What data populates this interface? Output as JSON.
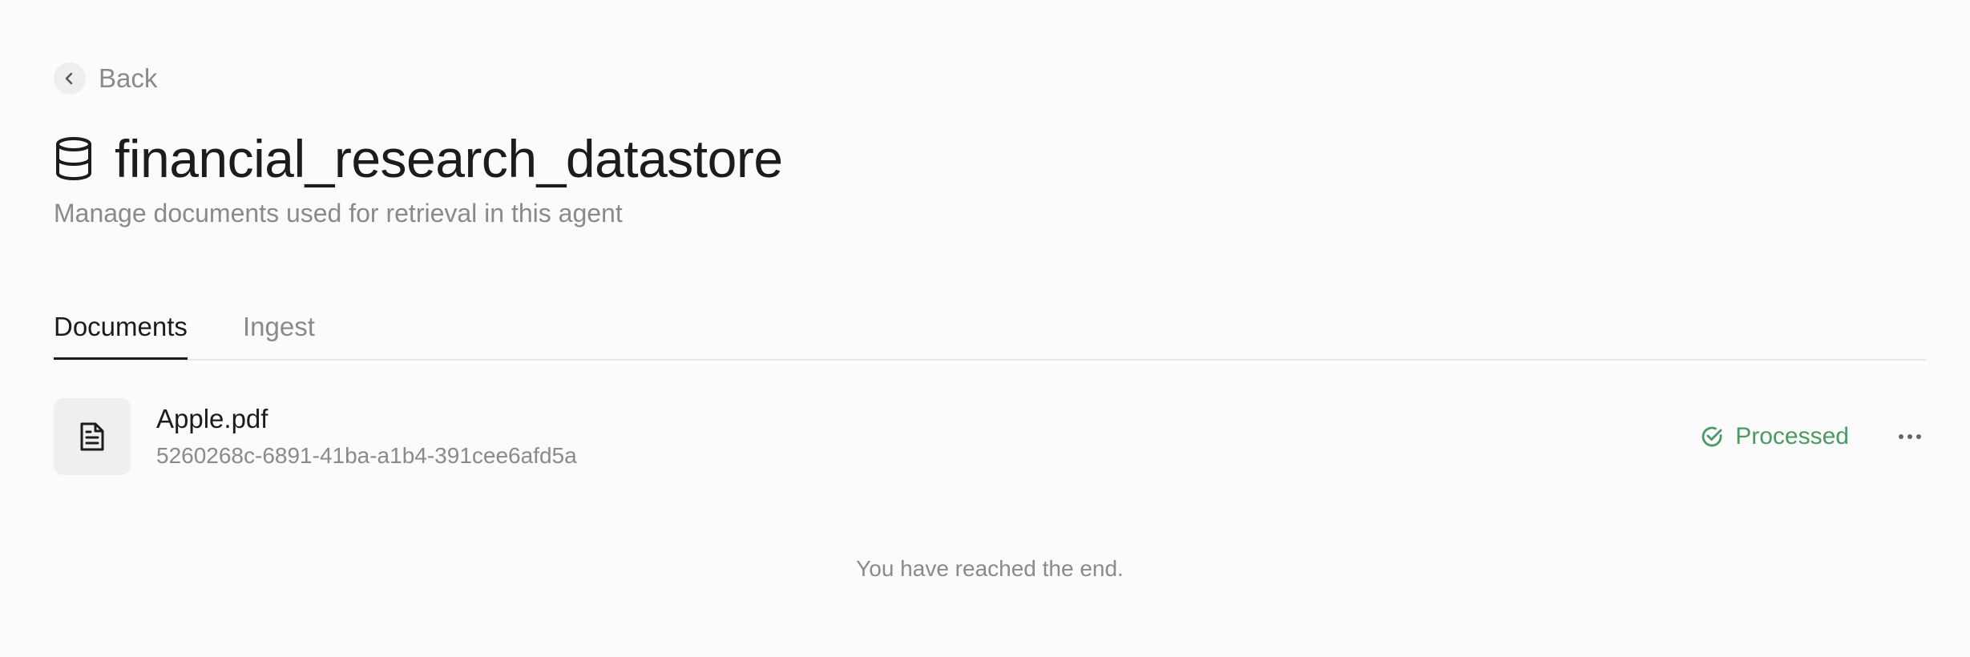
{
  "back": {
    "label": "Back",
    "icon": "chevron-left-icon"
  },
  "header": {
    "icon": "database-icon",
    "title": "financial_research_datastore",
    "subtitle": "Manage documents used for retrieval in this agent"
  },
  "tabs": [
    {
      "label": "Documents",
      "active": true
    },
    {
      "label": "Ingest",
      "active": false
    }
  ],
  "documents": [
    {
      "icon": "file-text-icon",
      "name": "Apple.pdf",
      "id": "5260268c-6891-41ba-a1b4-391cee6afd5a",
      "status": "Processed",
      "status_icon": "check-circle-icon",
      "status_color": "#4a9a61"
    }
  ],
  "list_end_message": "You have reached the end."
}
